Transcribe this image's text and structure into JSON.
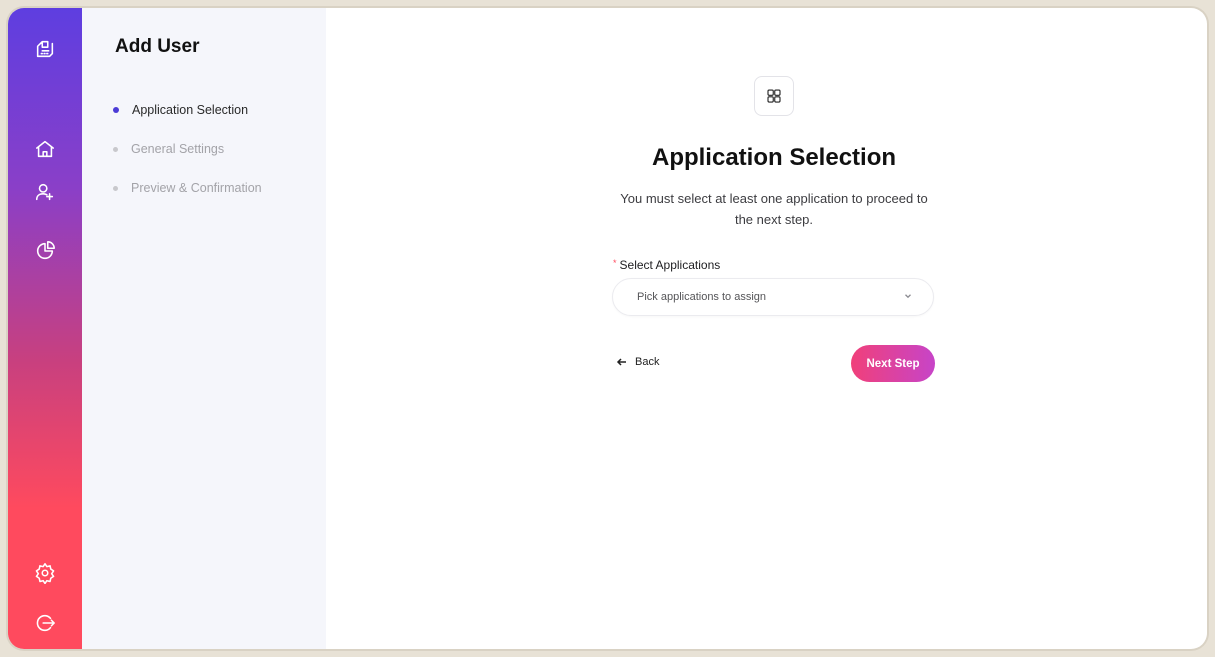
{
  "rail": {
    "icons": [
      "logo-icon",
      "home-icon",
      "users-icon",
      "pie-chart-icon",
      "settings-icon",
      "logout-icon"
    ]
  },
  "steps_panel": {
    "title": "Add User",
    "steps": [
      {
        "label": "Application Selection",
        "state": "active"
      },
      {
        "label": "General Settings",
        "state": "inactive"
      },
      {
        "label": "Preview & Confirmation",
        "state": "inactive"
      }
    ]
  },
  "main": {
    "badge_icon": "grid-icon",
    "heading": "Application Selection",
    "description": "You must select at least one application to proceed to the next step.",
    "field": {
      "required_mark": "*",
      "label": "Select Applications",
      "placeholder": "Pick applications to assign"
    },
    "back_label": "Back",
    "next_label": "Next Step"
  },
  "colors": {
    "accent_purple": "#4b3bd6",
    "accent_pink": "#f0407a",
    "rail_top": "#5e3ee0",
    "rail_bottom": "#ff4a5e"
  }
}
